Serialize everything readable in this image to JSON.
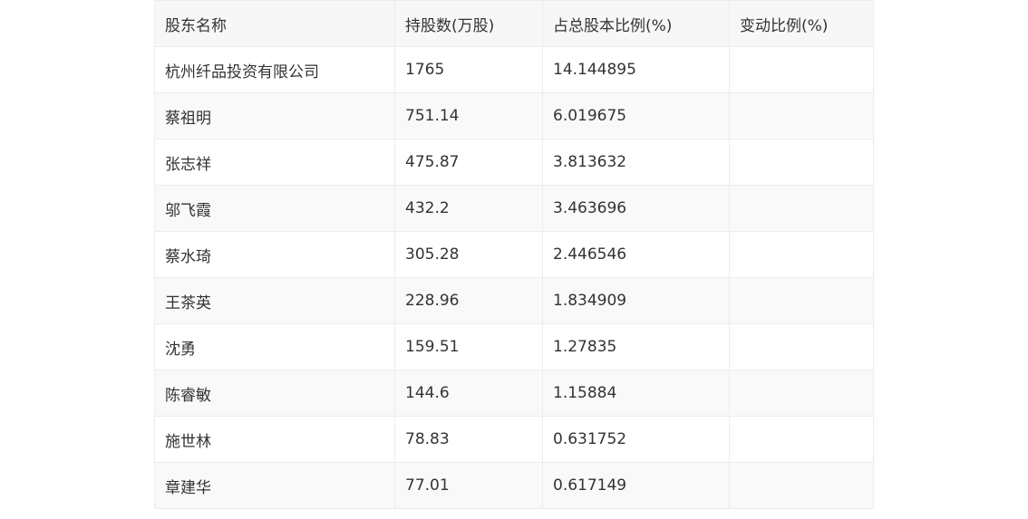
{
  "table": {
    "headers": [
      "股东名称",
      "持股数(万股)",
      "占总股本比例(%)",
      "变动比例(%)"
    ],
    "rows": [
      [
        "杭州纤品投资有限公司",
        "1765",
        "14.144895",
        ""
      ],
      [
        "蔡祖明",
        "751.14",
        "6.019675",
        ""
      ],
      [
        "张志祥",
        "475.87",
        "3.813632",
        ""
      ],
      [
        "邬飞霞",
        "432.2",
        "3.463696",
        ""
      ],
      [
        "蔡水琦",
        "305.28",
        "2.446546",
        ""
      ],
      [
        "王茶英",
        "228.96",
        "1.834909",
        ""
      ],
      [
        "沈勇",
        "159.51",
        "1.27835",
        ""
      ],
      [
        "陈睿敏",
        "144.6",
        "1.15884",
        ""
      ],
      [
        "施世林",
        "78.83",
        "0.631752",
        ""
      ],
      [
        "章建华",
        "77.01",
        "0.617149",
        ""
      ]
    ]
  }
}
